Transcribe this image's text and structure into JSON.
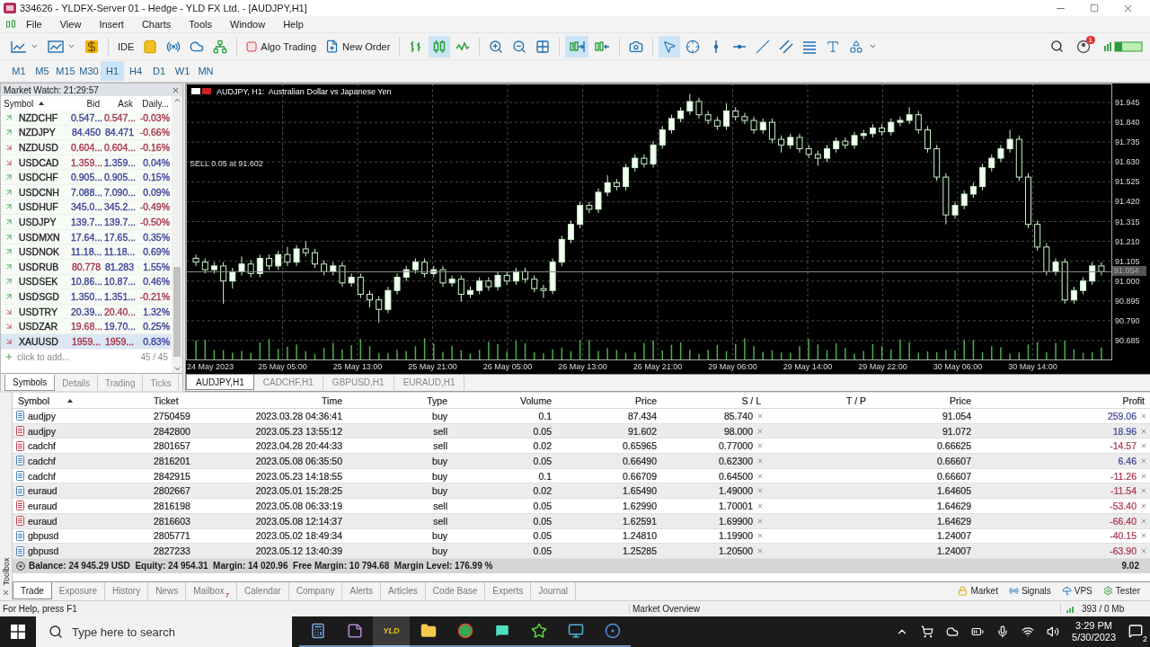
{
  "window": {
    "title": "334626 - YLDFX-Server 01 - Hedge - YLD FX Ltd. - [AUDJPY,H1]"
  },
  "menu": [
    "File",
    "View",
    "Insert",
    "Charts",
    "Tools",
    "Window",
    "Help"
  ],
  "toolbar": {
    "ide_label": "IDE",
    "algo_trading": "Algo Trading",
    "new_order": "New Order",
    "notification_count": "1",
    "chart_types": [
      {
        "kind": "bars",
        "selected": false
      },
      {
        "kind": "candles",
        "selected": true
      },
      {
        "kind": "line",
        "selected": false
      }
    ],
    "auto_scroll": true,
    "chart_shift": false,
    "tools": [
      {
        "kind": "cursor",
        "selected": true
      },
      {
        "kind": "crosshair",
        "selected": false
      },
      {
        "kind": "vertical",
        "selected": false
      },
      {
        "kind": "horizontal",
        "selected": false
      },
      {
        "kind": "trend",
        "selected": false
      },
      {
        "kind": "channel",
        "selected": false
      },
      {
        "kind": "fibo",
        "selected": false
      },
      {
        "kind": "text",
        "selected": false
      },
      {
        "kind": "shapes",
        "selected": false
      }
    ]
  },
  "timeframes": [
    {
      "label": "M1",
      "selected": false
    },
    {
      "label": "M5",
      "selected": false
    },
    {
      "label": "M15",
      "selected": false
    },
    {
      "label": "M30",
      "selected": false
    },
    {
      "label": "H1",
      "selected": true
    },
    {
      "label": "H4",
      "selected": false
    },
    {
      "label": "D1",
      "selected": false
    },
    {
      "label": "W1",
      "selected": false
    },
    {
      "label": "MN",
      "selected": false
    }
  ],
  "market_watch": {
    "title": "Market Watch: 21:29:57",
    "columns": [
      "Symbol",
      "Bid",
      "Ask",
      "Daily..."
    ],
    "rows": [
      {
        "kind": "rising",
        "symbol": "NZDCHF",
        "bid": {
          "text": "0.547...",
          "color": "#3b3f95"
        },
        "ask": {
          "text": "0.547...",
          "color": "#a8324a"
        },
        "daily": {
          "text": "-0.03%",
          "color": "#a8324a"
        },
        "selected": false
      },
      {
        "kind": "rising",
        "symbol": "NZDJPY",
        "bid": {
          "text": "84.450",
          "color": "#3b3f95"
        },
        "ask": {
          "text": "84.471",
          "color": "#3b3f95"
        },
        "daily": {
          "text": "-0.66%",
          "color": "#a8324a"
        },
        "selected": false
      },
      {
        "kind": "falling",
        "symbol": "NZDUSD",
        "bid": {
          "text": "0.604...",
          "color": "#a8324a"
        },
        "ask": {
          "text": "0.604...",
          "color": "#a8324a"
        },
        "daily": {
          "text": "-0.16%",
          "color": "#a8324a"
        },
        "selected": false
      },
      {
        "kind": "falling",
        "symbol": "USDCAD",
        "bid": {
          "text": "1.359...",
          "color": "#a8324a"
        },
        "ask": {
          "text": "1.359...",
          "color": "#3b3f95"
        },
        "daily": {
          "text": "0.04%",
          "color": "#3b3f95"
        },
        "selected": false
      },
      {
        "kind": "rising",
        "symbol": "USDCHF",
        "bid": {
          "text": "0.905...",
          "color": "#3b3f95"
        },
        "ask": {
          "text": "0.905...",
          "color": "#3b3f95"
        },
        "daily": {
          "text": "0.15%",
          "color": "#3b3f95"
        },
        "selected": false
      },
      {
        "kind": "rising",
        "symbol": "USDCNH",
        "bid": {
          "text": "7.088...",
          "color": "#3b3f95"
        },
        "ask": {
          "text": "7.090...",
          "color": "#3b3f95"
        },
        "daily": {
          "text": "0.09%",
          "color": "#3b3f95"
        },
        "selected": false
      },
      {
        "kind": "rising",
        "symbol": "USDHUF",
        "bid": {
          "text": "345.0...",
          "color": "#3b3f95"
        },
        "ask": {
          "text": "345.2...",
          "color": "#3b3f95"
        },
        "daily": {
          "text": "-0.49%",
          "color": "#a8324a"
        },
        "selected": false
      },
      {
        "kind": "rising",
        "symbol": "USDJPY",
        "bid": {
          "text": "139.7...",
          "color": "#3b3f95"
        },
        "ask": {
          "text": "139.7...",
          "color": "#3b3f95"
        },
        "daily": {
          "text": "-0.50%",
          "color": "#a8324a"
        },
        "selected": false
      },
      {
        "kind": "rising",
        "symbol": "USDMXN",
        "bid": {
          "text": "17.64...",
          "color": "#3b3f95"
        },
        "ask": {
          "text": "17.65...",
          "color": "#3b3f95"
        },
        "daily": {
          "text": "0.35%",
          "color": "#3b3f95"
        },
        "selected": false
      },
      {
        "kind": "rising",
        "symbol": "USDNOK",
        "bid": {
          "text": "11.18...",
          "color": "#3b3f95"
        },
        "ask": {
          "text": "11.18...",
          "color": "#3b3f95"
        },
        "daily": {
          "text": "0.69%",
          "color": "#3b3f95"
        },
        "selected": false
      },
      {
        "kind": "rising",
        "symbol": "USDRUB",
        "bid": {
          "text": "80.778",
          "color": "#a8324a"
        },
        "ask": {
          "text": "81.283",
          "color": "#3b3f95"
        },
        "daily": {
          "text": "1.55%",
          "color": "#3b3f95"
        },
        "selected": false
      },
      {
        "kind": "rising",
        "symbol": "USDSEK",
        "bid": {
          "text": "10.86...",
          "color": "#3b3f95"
        },
        "ask": {
          "text": "10.87...",
          "color": "#3b3f95"
        },
        "daily": {
          "text": "0.46%",
          "color": "#3b3f95"
        },
        "selected": false
      },
      {
        "kind": "rising",
        "symbol": "USDSGD",
        "bid": {
          "text": "1.350...",
          "color": "#3b3f95"
        },
        "ask": {
          "text": "1.351...",
          "color": "#3b3f95"
        },
        "daily": {
          "text": "-0.21%",
          "color": "#a8324a"
        },
        "selected": false
      },
      {
        "kind": "falling",
        "symbol": "USDTRY",
        "bid": {
          "text": "20.39...",
          "color": "#3b3f95"
        },
        "ask": {
          "text": "20.40...",
          "color": "#a8324a"
        },
        "daily": {
          "text": "1.32%",
          "color": "#3b3f95"
        },
        "selected": false
      },
      {
        "kind": "falling",
        "symbol": "USDZAR",
        "bid": {
          "text": "19.68...",
          "color": "#a8324a"
        },
        "ask": {
          "text": "19.70...",
          "color": "#3b3f95"
        },
        "daily": {
          "text": "0.25%",
          "color": "#3b3f95"
        },
        "selected": false
      },
      {
        "kind": "falling",
        "symbol": "XAUUSD",
        "bid": {
          "text": "1959...",
          "color": "#a8324a"
        },
        "ask": {
          "text": "1959...",
          "color": "#a8324a"
        },
        "daily": {
          "text": "0.83%",
          "color": "#3b3f95"
        },
        "selected": true
      }
    ],
    "add_row": "click to add...",
    "count": "45 / 45",
    "tabs": [
      {
        "label": "Symbols",
        "selected": true
      },
      {
        "label": "Details",
        "selected": false
      },
      {
        "label": "Trading",
        "selected": false
      },
      {
        "label": "Ticks",
        "selected": false
      }
    ]
  },
  "chart": {
    "header": "AUDJPY, H1:  Australian Dollar vs Japanese Yen",
    "order_label": "SELL 0.05 at 91.602",
    "current_price": "91.054",
    "time_axis": [
      "24 May 2023",
      "25 May 05:00",
      "25 May 13:00",
      "25 May 21:00",
      "26 May 05:00",
      "26 May 13:00",
      "26 May 21:00",
      "29 May 06:00",
      "29 May 14:00",
      "29 May 22:00",
      "30 May 06:00",
      "30 May 14:00"
    ],
    "chart_data": {
      "type": "candlestick",
      "ylim": [
        90.585,
        92.045
      ],
      "grid": true,
      "yticks": [
        {
          "value": 91.945,
          "label": "91.945"
        },
        {
          "value": 91.84,
          "label": "91.840"
        },
        {
          "value": 91.735,
          "label": "91.735"
        },
        {
          "value": 91.63,
          "label": "91.630"
        },
        {
          "value": 91.525,
          "label": "91.525"
        },
        {
          "value": 91.42,
          "label": "91.420"
        },
        {
          "value": 91.315,
          "label": "91.315"
        },
        {
          "value": 91.21,
          "label": "91.210"
        },
        {
          "value": 91.105,
          "label": "91.105"
        },
        {
          "value": 91.0,
          "label": "91.000"
        },
        {
          "value": 90.895,
          "label": "90.895"
        },
        {
          "value": 90.79,
          "label": "90.790"
        },
        {
          "value": 90.685,
          "label": "90.685"
        }
      ],
      "ohlc": [
        [
          91.12,
          91.14,
          91.08,
          91.1
        ],
        [
          91.1,
          91.12,
          91.04,
          91.06
        ],
        [
          91.06,
          91.1,
          91.04,
          91.08
        ],
        [
          91.08,
          91.1,
          90.88,
          91.0
        ],
        [
          91.0,
          91.07,
          90.96,
          91.05
        ],
        [
          91.05,
          91.13,
          91.03,
          91.09
        ],
        [
          91.09,
          91.11,
          91.02,
          91.04
        ],
        [
          91.04,
          91.14,
          91.02,
          91.12
        ],
        [
          91.12,
          91.14,
          91.06,
          91.08
        ],
        [
          91.08,
          91.16,
          91.06,
          91.14
        ],
        [
          91.14,
          91.18,
          91.08,
          91.1
        ],
        [
          91.1,
          91.19,
          91.08,
          91.17
        ],
        [
          91.17,
          91.21,
          91.13,
          91.15
        ],
        [
          91.15,
          91.17,
          91.07,
          91.09
        ],
        [
          91.09,
          91.11,
          91.03,
          91.05
        ],
        [
          91.05,
          91.1,
          91.03,
          91.08
        ],
        [
          91.08,
          91.1,
          90.97,
          90.99
        ],
        [
          90.99,
          91.04,
          90.97,
          91.02
        ],
        [
          91.02,
          91.04,
          90.91,
          90.93
        ],
        [
          90.93,
          90.95,
          90.86,
          90.9
        ],
        [
          90.9,
          90.92,
          90.78,
          90.85
        ],
        [
          90.85,
          90.97,
          90.83,
          90.95
        ],
        [
          90.95,
          91.04,
          90.93,
          91.02
        ],
        [
          91.02,
          91.08,
          91.0,
          91.06
        ],
        [
          91.06,
          91.12,
          91.04,
          91.1
        ],
        [
          91.1,
          91.12,
          91.02,
          91.04
        ],
        [
          91.04,
          91.08,
          91.02,
          91.06
        ],
        [
          91.06,
          91.08,
          90.97,
          90.99
        ],
        [
          90.99,
          91.03,
          90.97,
          91.01
        ],
        [
          91.01,
          91.03,
          90.89,
          90.93
        ],
        [
          90.93,
          90.97,
          90.91,
          90.95
        ],
        [
          90.95,
          91.02,
          90.93,
          91.0
        ],
        [
          91.0,
          91.02,
          90.95,
          90.97
        ],
        [
          90.97,
          91.05,
          90.95,
          91.03
        ],
        [
          91.03,
          91.05,
          90.98,
          91.0
        ],
        [
          91.0,
          91.07,
          90.98,
          91.05
        ],
        [
          91.05,
          91.07,
          90.99,
          91.01
        ],
        [
          91.01,
          91.03,
          90.94,
          90.96
        ],
        [
          90.96,
          90.98,
          90.91,
          90.95
        ],
        [
          90.95,
          91.12,
          90.93,
          91.1
        ],
        [
          91.1,
          91.24,
          91.08,
          91.22
        ],
        [
          91.22,
          91.32,
          91.2,
          91.3
        ],
        [
          91.3,
          91.42,
          91.28,
          91.4
        ],
        [
          91.4,
          91.42,
          91.36,
          91.38
        ],
        [
          91.38,
          91.49,
          91.36,
          91.47
        ],
        [
          91.47,
          91.56,
          91.45,
          91.52
        ],
        [
          91.52,
          91.54,
          91.48,
          91.5
        ],
        [
          91.5,
          91.62,
          91.48,
          91.6
        ],
        [
          91.6,
          91.67,
          91.58,
          91.65
        ],
        [
          91.65,
          91.67,
          91.6,
          91.62
        ],
        [
          91.62,
          91.74,
          91.6,
          91.72
        ],
        [
          91.72,
          91.82,
          91.7,
          91.8
        ],
        [
          91.8,
          91.88,
          91.78,
          91.86
        ],
        [
          91.86,
          91.92,
          91.84,
          91.9
        ],
        [
          91.9,
          91.99,
          91.88,
          91.95
        ],
        [
          91.95,
          91.97,
          91.86,
          91.88
        ],
        [
          91.88,
          91.9,
          91.83,
          91.85
        ],
        [
          91.85,
          91.87,
          91.8,
          91.82
        ],
        [
          91.82,
          91.94,
          91.8,
          91.9
        ],
        [
          91.9,
          91.92,
          91.85,
          91.87
        ],
        [
          91.87,
          91.89,
          91.83,
          91.85
        ],
        [
          91.85,
          91.87,
          91.78,
          91.8
        ],
        [
          91.8,
          91.86,
          91.78,
          91.84
        ],
        [
          91.84,
          91.86,
          91.73,
          91.75
        ],
        [
          91.75,
          91.77,
          91.68,
          91.72
        ],
        [
          91.72,
          91.78,
          91.7,
          91.76
        ],
        [
          91.76,
          91.78,
          91.68,
          91.7
        ],
        [
          91.7,
          91.72,
          91.65,
          91.67
        ],
        [
          91.67,
          91.69,
          91.61,
          91.65
        ],
        [
          91.65,
          91.72,
          91.63,
          91.7
        ],
        [
          91.7,
          91.76,
          91.68,
          91.74
        ],
        [
          91.74,
          91.76,
          91.7,
          91.72
        ],
        [
          91.72,
          91.79,
          91.7,
          91.77
        ],
        [
          91.77,
          91.8,
          91.75,
          91.78
        ],
        [
          91.78,
          91.83,
          91.76,
          91.81
        ],
        [
          91.81,
          91.83,
          91.77,
          91.79
        ],
        [
          91.79,
          91.86,
          91.77,
          91.84
        ],
        [
          91.84,
          91.87,
          91.82,
          91.85
        ],
        [
          91.85,
          91.92,
          91.83,
          91.88
        ],
        [
          91.88,
          91.9,
          91.78,
          91.8
        ],
        [
          91.8,
          91.82,
          91.68,
          91.7
        ],
        [
          91.7,
          91.72,
          91.53,
          91.55
        ],
        [
          91.55,
          91.57,
          91.3,
          91.35
        ],
        [
          91.35,
          91.42,
          91.33,
          91.4
        ],
        [
          91.4,
          91.48,
          91.38,
          91.46
        ],
        [
          91.46,
          91.52,
          91.44,
          91.5
        ],
        [
          91.5,
          91.62,
          91.48,
          91.6
        ],
        [
          91.6,
          91.67,
          91.58,
          91.65
        ],
        [
          91.65,
          91.72,
          91.63,
          91.7
        ],
        [
          91.7,
          91.8,
          91.68,
          91.75
        ],
        [
          91.75,
          91.77,
          91.53,
          91.55
        ],
        [
          91.55,
          91.57,
          91.28,
          91.3
        ],
        [
          91.3,
          91.32,
          91.16,
          91.18
        ],
        [
          91.18,
          91.2,
          91.03,
          91.05
        ],
        [
          91.05,
          91.12,
          91.03,
          91.1
        ],
        [
          91.1,
          91.12,
          90.88,
          90.9
        ],
        [
          90.9,
          90.97,
          90.88,
          90.95
        ],
        [
          90.95,
          91.02,
          90.93,
          91.0
        ],
        [
          91.0,
          91.1,
          90.98,
          91.08
        ],
        [
          91.08,
          91.1,
          91.03,
          91.05
        ]
      ]
    },
    "tabs": [
      {
        "label": "AUDJPY,H1",
        "selected": true
      },
      {
        "label": "CADCHF,H1",
        "selected": false
      },
      {
        "label": "GBPUSD,H1",
        "selected": false
      },
      {
        "label": "EURAUD,H1",
        "selected": false
      }
    ]
  },
  "toolbox": {
    "side_label": "Toolbox",
    "columns": [
      "Symbol",
      "Ticket",
      "Time",
      "Type",
      "Volume",
      "Price",
      "S / L",
      "T / P",
      "Price",
      "Profit"
    ],
    "rows": [
      {
        "kind": "buy",
        "symbol": "audjpy",
        "ticket": "2750459",
        "time": "2023.03.28 04:36:41",
        "type": "buy",
        "volume": "0.1",
        "price": "87.434",
        "sl": "85.740",
        "current_price": "91.054",
        "profit": {
          "text": "259.06",
          "color": "#3b3f95"
        }
      },
      {
        "kind": "sell",
        "symbol": "audjpy",
        "ticket": "2842800",
        "time": "2023.05.23 13:55:12",
        "type": "sell",
        "volume": "0.05",
        "price": "91.602",
        "sl": "98.000",
        "current_price": "91.072",
        "profit": {
          "text": "18.96",
          "color": "#3b3f95"
        }
      },
      {
        "kind": "sell",
        "symbol": "cadchf",
        "ticket": "2801657",
        "time": "2023.04.28 20:44:33",
        "type": "sell",
        "volume": "0.02",
        "price": "0.65965",
        "sl": "0.77000",
        "current_price": "0.66625",
        "profit": {
          "text": "-14.57",
          "color": "#a8324a"
        }
      },
      {
        "kind": "buy",
        "symbol": "cadchf",
        "ticket": "2816201",
        "time": "2023.05.08 06:35:50",
        "type": "buy",
        "volume": "0.05",
        "price": "0.66490",
        "sl": "0.62300",
        "current_price": "0.66607",
        "profit": {
          "text": "6.46",
          "color": "#3b3f95"
        }
      },
      {
        "kind": "buy",
        "symbol": "cadchf",
        "ticket": "2842915",
        "time": "2023.05.23 14:18:55",
        "type": "buy",
        "volume": "0.1",
        "price": "0.66709",
        "sl": "0.64500",
        "current_price": "0.66607",
        "profit": {
          "text": "-11.26",
          "color": "#a8324a"
        }
      },
      {
        "kind": "buy",
        "symbol": "euraud",
        "ticket": "2802667",
        "time": "2023.05.01 15:28:25",
        "type": "buy",
        "volume": "0.02",
        "price": "1.65490",
        "sl": "1.49000",
        "current_price": "1.64605",
        "profit": {
          "text": "-11.54",
          "color": "#a8324a"
        }
      },
      {
        "kind": "sell",
        "symbol": "euraud",
        "ticket": "2816198",
        "time": "2023.05.08 06:33:19",
        "type": "sell",
        "volume": "0.05",
        "price": "1.62990",
        "sl": "1.70001",
        "current_price": "1.64629",
        "profit": {
          "text": "-53.40",
          "color": "#a8324a"
        }
      },
      {
        "kind": "sell",
        "symbol": "euraud",
        "ticket": "2816603",
        "time": "2023.05.08 12:14:37",
        "type": "sell",
        "volume": "0.05",
        "price": "1.62591",
        "sl": "1.69900",
        "current_price": "1.64629",
        "profit": {
          "text": "-66.40",
          "color": "#a8324a"
        }
      },
      {
        "kind": "buy",
        "symbol": "gbpusd",
        "ticket": "2805771",
        "time": "2023.05.02 18:49:34",
        "type": "buy",
        "volume": "0.05",
        "price": "1.24810",
        "sl": "1.19900",
        "current_price": "1.24007",
        "profit": {
          "text": "-40.15",
          "color": "#a8324a"
        }
      },
      {
        "kind": "buy",
        "symbol": "gbpusd",
        "ticket": "2827233",
        "time": "2023.05.12 13:40:39",
        "type": "buy",
        "volume": "0.05",
        "price": "1.25285",
        "sl": "1.20500",
        "current_price": "1.24007",
        "profit": {
          "text": "-63.90",
          "color": "#a8324a"
        }
      }
    ],
    "summary": "Balance: 24 945.29 USD  Equity: 24 954.31  Margin: 14 020.96  Free Margin: 10 794.68  Margin Level: 176.99 %",
    "total_profit": "9.02",
    "tabs": [
      {
        "label": "Trade",
        "selected": true
      },
      {
        "label": "Exposure",
        "selected": false
      },
      {
        "label": "History",
        "selected": false
      },
      {
        "label": "News",
        "selected": false
      },
      {
        "label": "Mailbox",
        "badge": "7",
        "selected": false
      },
      {
        "label": "Calendar",
        "selected": false
      },
      {
        "label": "Company",
        "selected": false
      },
      {
        "label": "Alerts",
        "selected": false
      },
      {
        "label": "Articles",
        "selected": false
      },
      {
        "label": "Code Base",
        "selected": false
      },
      {
        "label": "Experts",
        "selected": false
      },
      {
        "label": "Journal",
        "selected": false
      }
    ],
    "right_tabs": [
      {
        "kind": "market",
        "label": "Market"
      },
      {
        "kind": "signals",
        "label": "Signals"
      },
      {
        "kind": "vps",
        "label": "VPS"
      },
      {
        "kind": "tester",
        "label": "Tester"
      }
    ]
  },
  "status_bar": {
    "help": "For Help, press F1",
    "profile": "Market Overview",
    "traffic": "393 / 0 Mb"
  },
  "taskbar": {
    "search_placeholder": "Type here to search",
    "apps": [
      {
        "kind": "calculator",
        "selected": false
      },
      {
        "kind": "notes",
        "selected": false
      },
      {
        "kind": "terminal",
        "label": "YLD",
        "selected": true
      },
      {
        "kind": "folder",
        "selected": false
      },
      {
        "kind": "browser",
        "selected": false
      },
      {
        "kind": "chat",
        "selected": false
      },
      {
        "kind": "star",
        "selected": false
      },
      {
        "kind": "monitor",
        "selected": false
      },
      {
        "kind": "ring",
        "selected": false
      }
    ],
    "time": "3:29 PM",
    "date": "5/30/2023",
    "notifications": "2"
  }
}
